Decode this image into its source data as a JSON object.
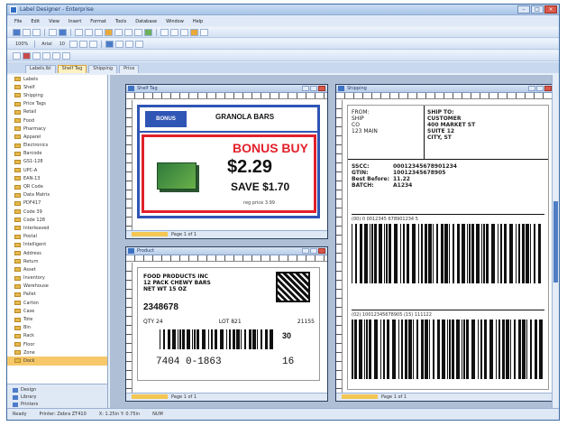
{
  "app": {
    "title": "Label Designer - Enterprise",
    "window_buttons": [
      "–",
      "□",
      "×"
    ]
  },
  "menubar": [
    "File",
    "Edit",
    "View",
    "Insert",
    "Format",
    "Tools",
    "Database",
    "Window",
    "Help"
  ],
  "toolbar": {
    "zoom": "100%",
    "font": "Arial",
    "size": "10"
  },
  "doc_tabs": [
    "Labels.lbl",
    "Shelf Tag",
    "Shipping",
    "Price"
  ],
  "sidebar": {
    "items": [
      "Labels",
      "Shelf",
      "Shipping",
      "Price Tags",
      "Retail",
      "Food",
      "Pharmacy",
      "Apparel",
      "Electronics",
      "Barcode",
      "GS1-128",
      "UPC-A",
      "EAN-13",
      "QR Code",
      "Data Matrix",
      "PDF417",
      "Code 39",
      "Code 128",
      "Interleaved",
      "Postal",
      "Intelligent",
      "Address",
      "Return",
      "Asset",
      "Inventory",
      "Warehouse",
      "Pallet",
      "Carton",
      "Case",
      "Tote",
      "Bin",
      "Rack",
      "Floor",
      "Zone",
      "Dock"
    ],
    "bottom": [
      "Design",
      "Library",
      "Printers"
    ]
  },
  "panels": {
    "p1_title": "Shelf Tag",
    "p2_title": "Product",
    "p3_title": "Shipping",
    "status": "Page 1 of 1"
  },
  "label1": {
    "logo": "BONUS",
    "header": "GRANOLA BARS",
    "bonus": "BONUS BUY",
    "price": "$2.29",
    "save": "SAVE $1.70",
    "fine": "reg price 3.99"
  },
  "label2": {
    "lines": "FOOD PRODUCTS INC\n12 PACK CHEWY BARS\nNET WT 15 OZ",
    "sku": "2348678",
    "mid_left": "QTY 24",
    "mid_center": "LOT 821",
    "mid_right": "21155",
    "big": "30",
    "bottom_left": "7404 0-1863",
    "bottom_right": "16"
  },
  "label3": {
    "from": [
      "FROM:",
      "SHIP",
      "CO",
      "123 MAIN"
    ],
    "to": [
      "SHIP TO:",
      "CUSTOMER",
      "400 MARKET ST",
      "SUITE 12",
      "CITY, ST"
    ],
    "fields": [
      {
        "k": "SSCC:",
        "v": "00012345678901234"
      },
      {
        "k": "GTIN:",
        "v": "10012345678905"
      },
      {
        "k": "Best Before:",
        "v": "11.22"
      },
      {
        "k": "BATCH:",
        "v": "A1234"
      }
    ],
    "bar1_cap": "(00) 0 0012345 678901234 5",
    "bar2_cap": "(02) 10012345678905 (15) 111122"
  },
  "statusbar": [
    "Ready",
    "Printer: Zebra ZT410",
    "X: 1.25in Y: 0.75in",
    "NUM"
  ],
  "colors": {
    "accent": "#2f55b5",
    "bonus_red": "#e2202b",
    "sel": "#f6c86a"
  }
}
